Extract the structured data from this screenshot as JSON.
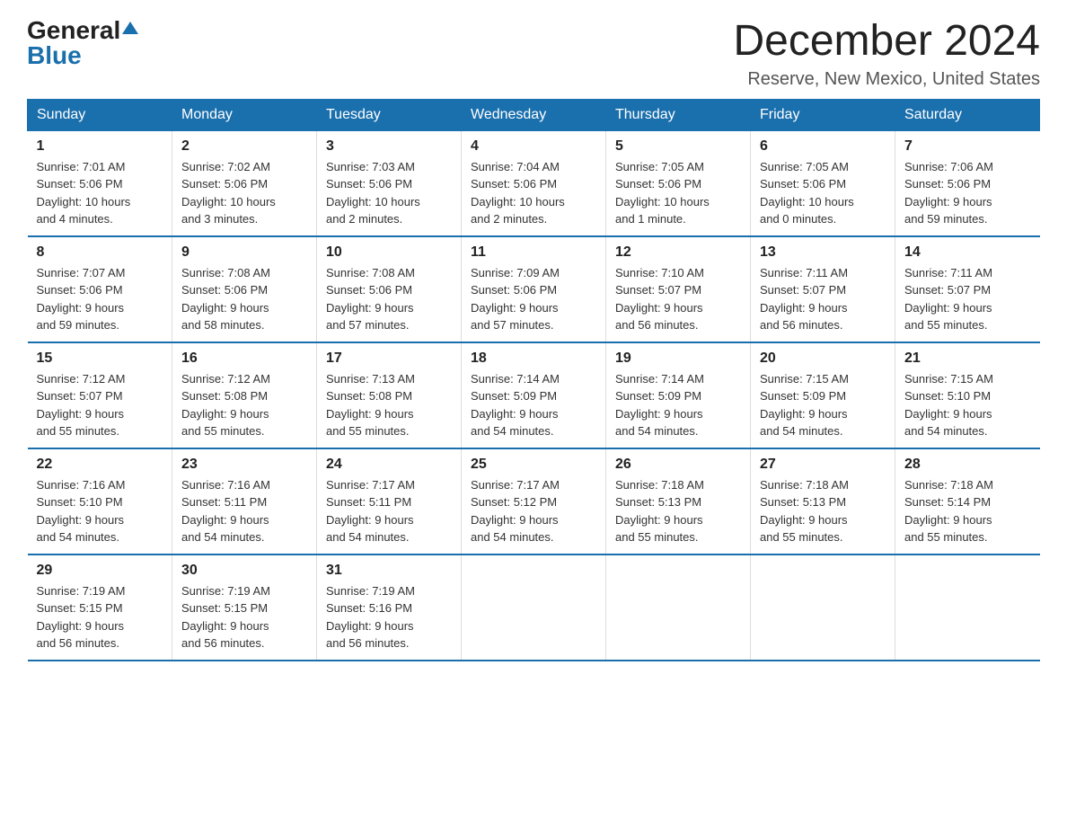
{
  "logo": {
    "general": "General",
    "blue": "Blue"
  },
  "header": {
    "month": "December 2024",
    "location": "Reserve, New Mexico, United States"
  },
  "weekdays": [
    "Sunday",
    "Monday",
    "Tuesday",
    "Wednesday",
    "Thursday",
    "Friday",
    "Saturday"
  ],
  "weeks": [
    [
      {
        "day": "1",
        "sunrise": "7:01 AM",
        "sunset": "5:06 PM",
        "daylight": "10 hours and 4 minutes."
      },
      {
        "day": "2",
        "sunrise": "7:02 AM",
        "sunset": "5:06 PM",
        "daylight": "10 hours and 3 minutes."
      },
      {
        "day": "3",
        "sunrise": "7:03 AM",
        "sunset": "5:06 PM",
        "daylight": "10 hours and 2 minutes."
      },
      {
        "day": "4",
        "sunrise": "7:04 AM",
        "sunset": "5:06 PM",
        "daylight": "10 hours and 2 minutes."
      },
      {
        "day": "5",
        "sunrise": "7:05 AM",
        "sunset": "5:06 PM",
        "daylight": "10 hours and 1 minute."
      },
      {
        "day": "6",
        "sunrise": "7:05 AM",
        "sunset": "5:06 PM",
        "daylight": "10 hours and 0 minutes."
      },
      {
        "day": "7",
        "sunrise": "7:06 AM",
        "sunset": "5:06 PM",
        "daylight": "9 hours and 59 minutes."
      }
    ],
    [
      {
        "day": "8",
        "sunrise": "7:07 AM",
        "sunset": "5:06 PM",
        "daylight": "9 hours and 59 minutes."
      },
      {
        "day": "9",
        "sunrise": "7:08 AM",
        "sunset": "5:06 PM",
        "daylight": "9 hours and 58 minutes."
      },
      {
        "day": "10",
        "sunrise": "7:08 AM",
        "sunset": "5:06 PM",
        "daylight": "9 hours and 57 minutes."
      },
      {
        "day": "11",
        "sunrise": "7:09 AM",
        "sunset": "5:06 PM",
        "daylight": "9 hours and 57 minutes."
      },
      {
        "day": "12",
        "sunrise": "7:10 AM",
        "sunset": "5:07 PM",
        "daylight": "9 hours and 56 minutes."
      },
      {
        "day": "13",
        "sunrise": "7:11 AM",
        "sunset": "5:07 PM",
        "daylight": "9 hours and 56 minutes."
      },
      {
        "day": "14",
        "sunrise": "7:11 AM",
        "sunset": "5:07 PM",
        "daylight": "9 hours and 55 minutes."
      }
    ],
    [
      {
        "day": "15",
        "sunrise": "7:12 AM",
        "sunset": "5:07 PM",
        "daylight": "9 hours and 55 minutes."
      },
      {
        "day": "16",
        "sunrise": "7:12 AM",
        "sunset": "5:08 PM",
        "daylight": "9 hours and 55 minutes."
      },
      {
        "day": "17",
        "sunrise": "7:13 AM",
        "sunset": "5:08 PM",
        "daylight": "9 hours and 55 minutes."
      },
      {
        "day": "18",
        "sunrise": "7:14 AM",
        "sunset": "5:09 PM",
        "daylight": "9 hours and 54 minutes."
      },
      {
        "day": "19",
        "sunrise": "7:14 AM",
        "sunset": "5:09 PM",
        "daylight": "9 hours and 54 minutes."
      },
      {
        "day": "20",
        "sunrise": "7:15 AM",
        "sunset": "5:09 PM",
        "daylight": "9 hours and 54 minutes."
      },
      {
        "day": "21",
        "sunrise": "7:15 AM",
        "sunset": "5:10 PM",
        "daylight": "9 hours and 54 minutes."
      }
    ],
    [
      {
        "day": "22",
        "sunrise": "7:16 AM",
        "sunset": "5:10 PM",
        "daylight": "9 hours and 54 minutes."
      },
      {
        "day": "23",
        "sunrise": "7:16 AM",
        "sunset": "5:11 PM",
        "daylight": "9 hours and 54 minutes."
      },
      {
        "day": "24",
        "sunrise": "7:17 AM",
        "sunset": "5:11 PM",
        "daylight": "9 hours and 54 minutes."
      },
      {
        "day": "25",
        "sunrise": "7:17 AM",
        "sunset": "5:12 PM",
        "daylight": "9 hours and 54 minutes."
      },
      {
        "day": "26",
        "sunrise": "7:18 AM",
        "sunset": "5:13 PM",
        "daylight": "9 hours and 55 minutes."
      },
      {
        "day": "27",
        "sunrise": "7:18 AM",
        "sunset": "5:13 PM",
        "daylight": "9 hours and 55 minutes."
      },
      {
        "day": "28",
        "sunrise": "7:18 AM",
        "sunset": "5:14 PM",
        "daylight": "9 hours and 55 minutes."
      }
    ],
    [
      {
        "day": "29",
        "sunrise": "7:19 AM",
        "sunset": "5:15 PM",
        "daylight": "9 hours and 56 minutes."
      },
      {
        "day": "30",
        "sunrise": "7:19 AM",
        "sunset": "5:15 PM",
        "daylight": "9 hours and 56 minutes."
      },
      {
        "day": "31",
        "sunrise": "7:19 AM",
        "sunset": "5:16 PM",
        "daylight": "9 hours and 56 minutes."
      },
      null,
      null,
      null,
      null
    ]
  ],
  "labels": {
    "sunrise": "Sunrise:",
    "sunset": "Sunset:",
    "daylight": "Daylight:"
  }
}
